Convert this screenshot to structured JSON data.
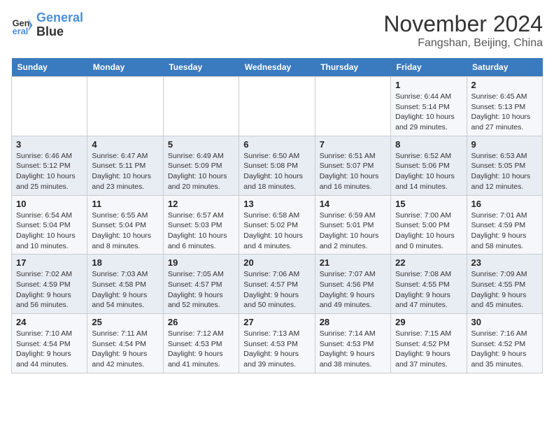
{
  "logo": {
    "line1": "General",
    "line2": "Blue"
  },
  "title": "November 2024",
  "subtitle": "Fangshan, Beijing, China",
  "weekdays": [
    "Sunday",
    "Monday",
    "Tuesday",
    "Wednesday",
    "Thursday",
    "Friday",
    "Saturday"
  ],
  "weeks": [
    [
      {
        "day": "",
        "info": ""
      },
      {
        "day": "",
        "info": ""
      },
      {
        "day": "",
        "info": ""
      },
      {
        "day": "",
        "info": ""
      },
      {
        "day": "",
        "info": ""
      },
      {
        "day": "1",
        "info": "Sunrise: 6:44 AM\nSunset: 5:14 PM\nDaylight: 10 hours\nand 29 minutes."
      },
      {
        "day": "2",
        "info": "Sunrise: 6:45 AM\nSunset: 5:13 PM\nDaylight: 10 hours\nand 27 minutes."
      }
    ],
    [
      {
        "day": "3",
        "info": "Sunrise: 6:46 AM\nSunset: 5:12 PM\nDaylight: 10 hours\nand 25 minutes."
      },
      {
        "day": "4",
        "info": "Sunrise: 6:47 AM\nSunset: 5:11 PM\nDaylight: 10 hours\nand 23 minutes."
      },
      {
        "day": "5",
        "info": "Sunrise: 6:49 AM\nSunset: 5:09 PM\nDaylight: 10 hours\nand 20 minutes."
      },
      {
        "day": "6",
        "info": "Sunrise: 6:50 AM\nSunset: 5:08 PM\nDaylight: 10 hours\nand 18 minutes."
      },
      {
        "day": "7",
        "info": "Sunrise: 6:51 AM\nSunset: 5:07 PM\nDaylight: 10 hours\nand 16 minutes."
      },
      {
        "day": "8",
        "info": "Sunrise: 6:52 AM\nSunset: 5:06 PM\nDaylight: 10 hours\nand 14 minutes."
      },
      {
        "day": "9",
        "info": "Sunrise: 6:53 AM\nSunset: 5:05 PM\nDaylight: 10 hours\nand 12 minutes."
      }
    ],
    [
      {
        "day": "10",
        "info": "Sunrise: 6:54 AM\nSunset: 5:04 PM\nDaylight: 10 hours\nand 10 minutes."
      },
      {
        "day": "11",
        "info": "Sunrise: 6:55 AM\nSunset: 5:04 PM\nDaylight: 10 hours\nand 8 minutes."
      },
      {
        "day": "12",
        "info": "Sunrise: 6:57 AM\nSunset: 5:03 PM\nDaylight: 10 hours\nand 6 minutes."
      },
      {
        "day": "13",
        "info": "Sunrise: 6:58 AM\nSunset: 5:02 PM\nDaylight: 10 hours\nand 4 minutes."
      },
      {
        "day": "14",
        "info": "Sunrise: 6:59 AM\nSunset: 5:01 PM\nDaylight: 10 hours\nand 2 minutes."
      },
      {
        "day": "15",
        "info": "Sunrise: 7:00 AM\nSunset: 5:00 PM\nDaylight: 10 hours\nand 0 minutes."
      },
      {
        "day": "16",
        "info": "Sunrise: 7:01 AM\nSunset: 4:59 PM\nDaylight: 9 hours\nand 58 minutes."
      }
    ],
    [
      {
        "day": "17",
        "info": "Sunrise: 7:02 AM\nSunset: 4:59 PM\nDaylight: 9 hours\nand 56 minutes."
      },
      {
        "day": "18",
        "info": "Sunrise: 7:03 AM\nSunset: 4:58 PM\nDaylight: 9 hours\nand 54 minutes."
      },
      {
        "day": "19",
        "info": "Sunrise: 7:05 AM\nSunset: 4:57 PM\nDaylight: 9 hours\nand 52 minutes."
      },
      {
        "day": "20",
        "info": "Sunrise: 7:06 AM\nSunset: 4:57 PM\nDaylight: 9 hours\nand 50 minutes."
      },
      {
        "day": "21",
        "info": "Sunrise: 7:07 AM\nSunset: 4:56 PM\nDaylight: 9 hours\nand 49 minutes."
      },
      {
        "day": "22",
        "info": "Sunrise: 7:08 AM\nSunset: 4:55 PM\nDaylight: 9 hours\nand 47 minutes."
      },
      {
        "day": "23",
        "info": "Sunrise: 7:09 AM\nSunset: 4:55 PM\nDaylight: 9 hours\nand 45 minutes."
      }
    ],
    [
      {
        "day": "24",
        "info": "Sunrise: 7:10 AM\nSunset: 4:54 PM\nDaylight: 9 hours\nand 44 minutes."
      },
      {
        "day": "25",
        "info": "Sunrise: 7:11 AM\nSunset: 4:54 PM\nDaylight: 9 hours\nand 42 minutes."
      },
      {
        "day": "26",
        "info": "Sunrise: 7:12 AM\nSunset: 4:53 PM\nDaylight: 9 hours\nand 41 minutes."
      },
      {
        "day": "27",
        "info": "Sunrise: 7:13 AM\nSunset: 4:53 PM\nDaylight: 9 hours\nand 39 minutes."
      },
      {
        "day": "28",
        "info": "Sunrise: 7:14 AM\nSunset: 4:53 PM\nDaylight: 9 hours\nand 38 minutes."
      },
      {
        "day": "29",
        "info": "Sunrise: 7:15 AM\nSunset: 4:52 PM\nDaylight: 9 hours\nand 37 minutes."
      },
      {
        "day": "30",
        "info": "Sunrise: 7:16 AM\nSunset: 4:52 PM\nDaylight: 9 hours\nand 35 minutes."
      }
    ]
  ]
}
